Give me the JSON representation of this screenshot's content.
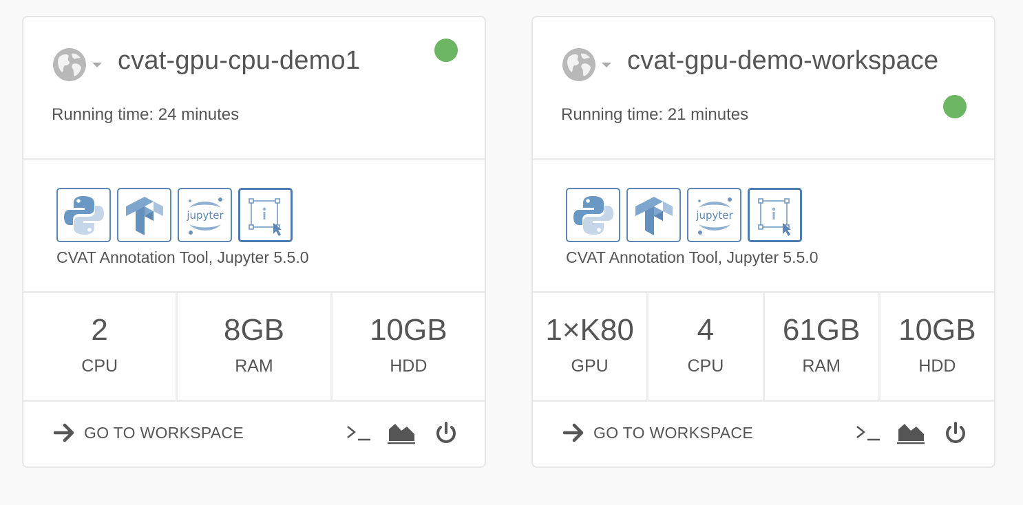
{
  "colors": {
    "status_running": "#6cb563",
    "icon_border": "#5b86b5",
    "text": "#555555"
  },
  "workspaces": [
    {
      "name": "cvat-gpu-cpu-demo1",
      "running_time": "Running time: 24 minutes",
      "status": "running",
      "apps": [
        "python-icon",
        "tensorflow-icon",
        "jupyter-icon",
        "cvat-icon"
      ],
      "apps_caption": "CVAT Annotation Tool, Jupyter 5.5.0",
      "resources": [
        {
          "value": "2",
          "label": "CPU"
        },
        {
          "value": "8GB",
          "label": "RAM"
        },
        {
          "value": "10GB",
          "label": "HDD"
        }
      ],
      "go_label": "GO TO WORKSPACE",
      "actions": [
        "terminal-icon",
        "metrics-icon",
        "power-icon"
      ]
    },
    {
      "name": "cvat-gpu-demo-workspace",
      "running_time": "Running time: 21 minutes",
      "status": "running",
      "apps": [
        "python-icon",
        "tensorflow-icon",
        "jupyter-icon",
        "cvat-icon"
      ],
      "apps_caption": "CVAT Annotation Tool, Jupyter 5.5.0",
      "resources": [
        {
          "value": "1×K80",
          "label": "GPU"
        },
        {
          "value": "4",
          "label": "CPU"
        },
        {
          "value": "61GB",
          "label": "RAM"
        },
        {
          "value": "10GB",
          "label": "HDD"
        }
      ],
      "go_label": "GO TO WORKSPACE",
      "actions": [
        "terminal-icon",
        "metrics-icon",
        "power-icon"
      ]
    }
  ]
}
